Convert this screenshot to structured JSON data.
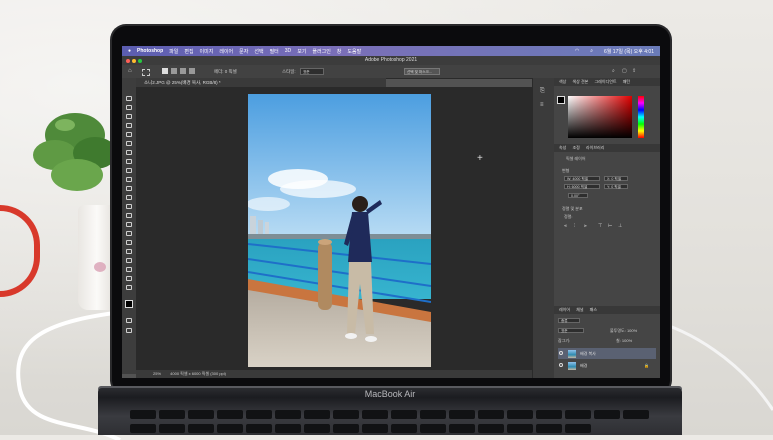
{
  "scene": {
    "laptop_model": "MacBook Air"
  },
  "screen": {
    "menubar": {
      "items": [
        "Photoshop",
        "파일",
        "편집",
        "이미지",
        "레이어",
        "문자",
        "선택",
        "필터",
        "3D",
        "보기",
        "플러그인",
        "창",
        "도움말"
      ],
      "clock": "6월 17일 (목) 오후 4:01"
    },
    "window_title": "Adobe Photoshop 2021",
    "options": {
      "feather": "페더: 0 픽셀",
      "style_label": "스타일:",
      "style_value": "표준",
      "select_mask": "선택 및 마스크..."
    },
    "doc_tab": "소니2.JPG @ 25%(배경 복사, RGB/8) *",
    "status": {
      "zoom": "25%",
      "doc_info": "4000 픽셀 x 6000 픽셀 (300 ppi)"
    },
    "panels": {
      "color_tabs": [
        "색상",
        "색상 견본",
        "그레이디언트",
        "패턴"
      ],
      "props_tabs": [
        "속성",
        "조정",
        "라이브러리"
      ],
      "layer_kind": "픽셀 레이어",
      "transform_title": "변형",
      "W": "W: 4000 픽셀",
      "H": "H: 6000 픽셀",
      "X": "X: 0 픽셀",
      "Y": "Y: 0 픽셀",
      "angle": "0.00°",
      "align_title": "정렬 및 분포",
      "align_label": "정렬:",
      "layers_tabs": [
        "레이어",
        "채널",
        "패스"
      ],
      "kind_filter": "종류",
      "blend_mode": "표준",
      "opacity": "불투명도: 100%",
      "lock_label": "잠그기:",
      "fill": "칠: 100%",
      "layers": [
        {
          "name": "배경 복사",
          "selected": true
        },
        {
          "name": "배경",
          "selected": false
        }
      ]
    }
  }
}
